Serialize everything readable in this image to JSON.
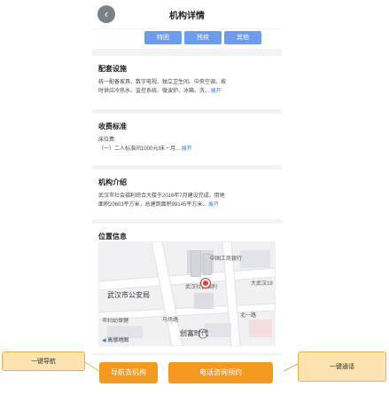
{
  "header": {
    "title": "机构详情",
    "back_icon": "chevron-left-icon"
  },
  "tags": [
    "特困",
    "残疾",
    "其他"
  ],
  "facilities": {
    "title": "配套设施",
    "line1": "统一配备家具、数字电视、独立卫生间、中央空调、按",
    "line2": "时供应冷热水、监控系统、微波炉、冰箱、洗...",
    "expand": "展开"
  },
  "fees": {
    "title": "收费标准",
    "line1": "床位费:",
    "line2": "（一）二人标准间1000元/床・月...",
    "expand": "展开"
  },
  "intro": {
    "title": "机构介绍",
    "line1": "武汉市社会福利综合大楼于2016年7月建设完成，用地",
    "line2": "面积20603平方米，总建筑面积99145平方米...",
    "expand": "展开"
  },
  "location": {
    "title": "位置信息",
    "map_labels": {
      "bank": "中国工商银行",
      "center": "武汉社会福利",
      "police": "武汉市公安局",
      "bldg": "大武汉19",
      "road": "马场路",
      "plaza": "创富时代",
      "logo": "高德地图",
      "north": "北一路",
      "hosp": "市妇幼保健"
    }
  },
  "bottom": {
    "nav_label": "导航去机构",
    "call_label": "电话咨询预约"
  },
  "callouts": {
    "left": "一键导航",
    "right": "一键通话"
  },
  "colors": {
    "accent": "#f39a1e",
    "tag": "#6a9cf0",
    "link": "#3f7ee8",
    "callout_bg": "#fde3b0"
  }
}
